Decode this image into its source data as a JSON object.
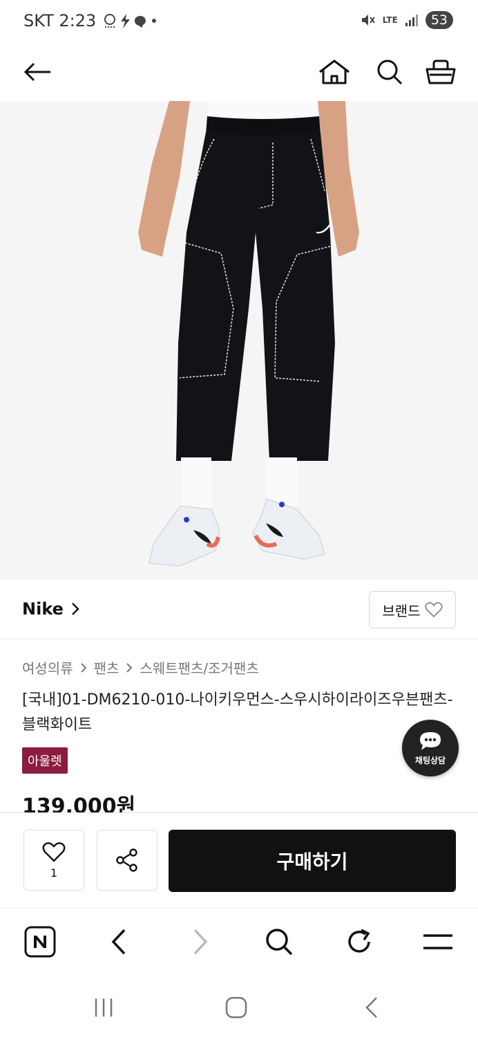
{
  "status_bar": {
    "carrier_time": "SKT 2:23",
    "network": "LTE",
    "battery": "53"
  },
  "brand": {
    "name": "Nike",
    "follow_label": "브랜드"
  },
  "breadcrumb": [
    "여성의류",
    "팬츠",
    "스웨트팬츠/조거팬츠"
  ],
  "product": {
    "title": "[국내]01-DM6210-010-나이키우먼스-스우시하이라이즈우븐팬츠-블랙화이트",
    "badge": "아울렛",
    "price": "139,000원"
  },
  "chat": {
    "label": "채팅상담"
  },
  "purchase_bar": {
    "like_count": "1",
    "buy_label": "구매하기"
  },
  "colors": {
    "badge": "#8b1d3f",
    "buy_button": "#111111"
  }
}
